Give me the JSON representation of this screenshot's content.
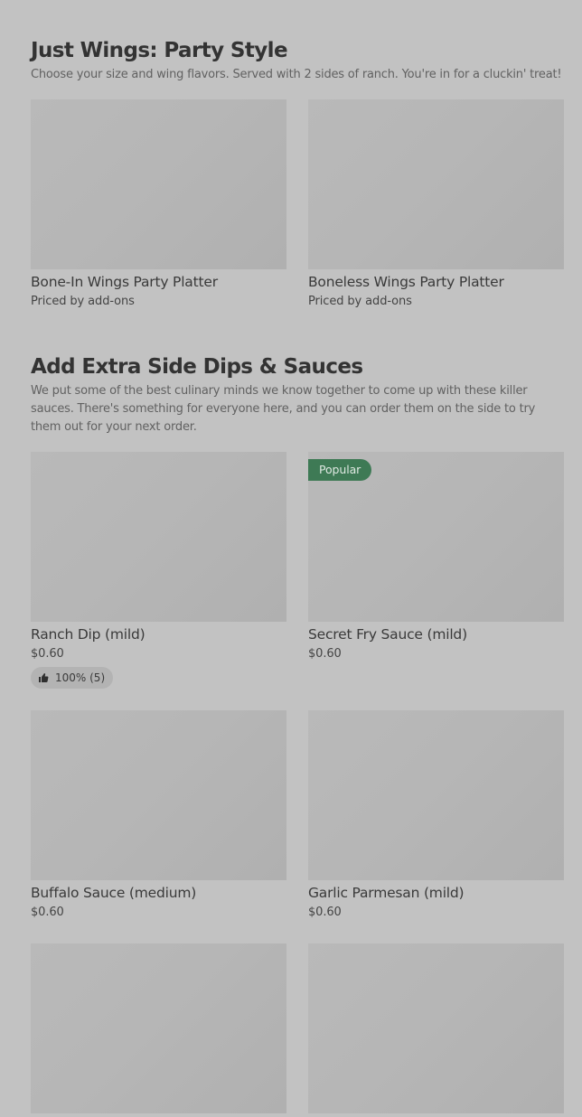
{
  "sections": [
    {
      "title": "Just Wings: Party Style",
      "description": "Choose your size and wing flavors. Served with 2 sides of ranch. You're in for a cluckin' treat!",
      "items": [
        {
          "name": "Bone-In Wings Party Platter",
          "price": "Priced by add-ons"
        },
        {
          "name": "Boneless Wings Party Platter",
          "price": "Priced by add-ons"
        }
      ]
    },
    {
      "title": "Add Extra Side Dips & Sauces",
      "description": "We put some of the best culinary minds we know together to come up with these killer sauces. There's something for everyone here, and you can order them on the side to try them out for your next order.",
      "items": [
        {
          "name": "Ranch Dip (mild)",
          "price": "$0.60",
          "rating": "100% (5)"
        },
        {
          "name": "Secret Fry Sauce (mild)",
          "price": "$0.60",
          "badge": "Popular"
        },
        {
          "name": "Buffalo Sauce (medium)",
          "price": "$0.60"
        },
        {
          "name": "Garlic Parmesan (mild)",
          "price": "$0.60"
        },
        {
          "name": "",
          "price": ""
        },
        {
          "name": "",
          "price": ""
        }
      ]
    }
  ],
  "icons": {
    "rating": "thumbs-up-icon"
  },
  "colors": {
    "background": "#c2c2c2",
    "image_placeholder": "#b6b6b6",
    "popular_badge": "#3e7a55",
    "rating_pill": "#b3b3b3"
  }
}
